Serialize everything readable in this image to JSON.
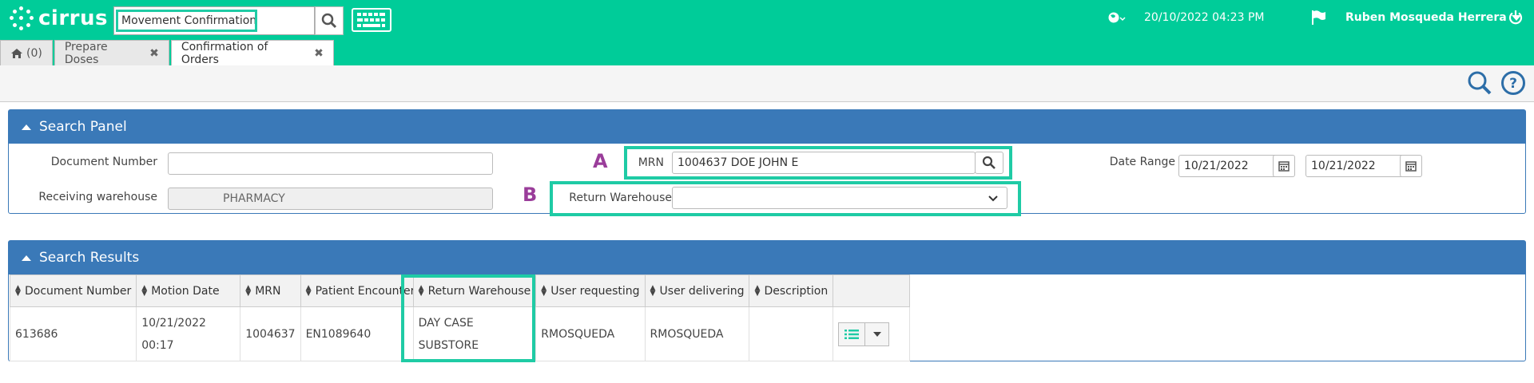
{
  "app": {
    "logo_text": "cirrus",
    "search_value": "Movement Confirmation",
    "datetime": "20/10/2022 04:23 PM",
    "user_name": "Ruben Mosqueda Herrera",
    "accent_color": "#00cc99"
  },
  "tabs": [
    {
      "label": "(0)",
      "icon": "home-icon"
    },
    {
      "label": "Prepare Doses",
      "closable": true
    },
    {
      "label": "Confirmation of Orders",
      "closable": true,
      "active": true
    }
  ],
  "search_panel": {
    "title": "Search Panel",
    "document_number_label": "Document Number",
    "document_number_value": "",
    "receiving_warehouse_label": "Receiving warehouse",
    "receiving_warehouse_value": "PHARMACY",
    "mrn_label": "MRN",
    "mrn_value": "1004637 DOE JOHN E",
    "return_warehouse_label": "Return Warehouse",
    "return_warehouse_value": "",
    "date_range_label": "Date Range",
    "date_from": "10/21/2022",
    "date_to": "10/21/2022",
    "marker_a": "A",
    "marker_b": "B"
  },
  "search_results": {
    "title": "Search Results",
    "columns": [
      "Document Number",
      "Motion Date",
      "MRN",
      "Patient Encounter",
      "Return Warehouse",
      "User requesting",
      "User delivering",
      "Description"
    ],
    "rows": [
      {
        "document_number": "613686",
        "motion_date_line1": "10/21/2022",
        "motion_date_line2": "00:17",
        "mrn": "1004637",
        "patient_encounter": "EN1089640",
        "return_warehouse_line1": "DAY CASE",
        "return_warehouse_line2": "SUBSTORE",
        "user_requesting": "RMOSQUEDA",
        "user_delivering": "RMOSQUEDA",
        "description": ""
      }
    ]
  }
}
